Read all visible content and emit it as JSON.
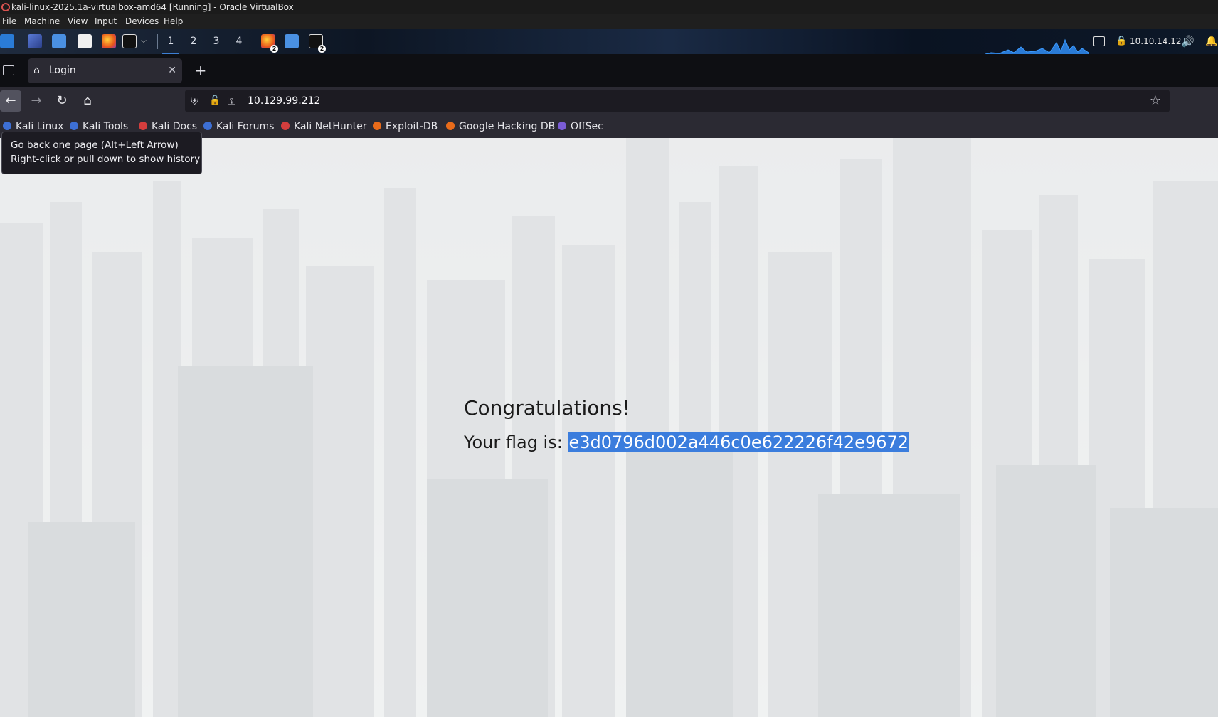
{
  "vbox": {
    "title": "kali-linux-2025.1a-virtualbox-amd64 [Running] - Oracle VirtualBox",
    "menu": [
      "File",
      "Machine",
      "View",
      "Input",
      "Devices",
      "Help"
    ]
  },
  "panel": {
    "workspaces": [
      "1",
      "2",
      "3",
      "4"
    ],
    "ip": "10.10.14.12",
    "badge_counts": [
      "2",
      "2"
    ]
  },
  "browser": {
    "tab_title": "Login",
    "new_tab": "+",
    "url": "10.129.99.212",
    "bookmarks": [
      {
        "label": "Kali Linux",
        "color": "#3d6fd4"
      },
      {
        "label": "Kali Tools",
        "color": "#3d6fd4"
      },
      {
        "label": "Kali Docs",
        "color": "#d43d3d"
      },
      {
        "label": "Kali Forums",
        "color": "#3d6fd4"
      },
      {
        "label": "Kali NetHunter",
        "color": "#d43d3d"
      },
      {
        "label": "Exploit-DB",
        "color": "#e86b1a"
      },
      {
        "label": "Google Hacking DB",
        "color": "#e86b1a"
      },
      {
        "label": "OffSec",
        "color": "#7a5cd6"
      }
    ],
    "tooltip": {
      "line1": "Go back one page (Alt+Left Arrow)",
      "line2": "Right-click or pull down to show history"
    }
  },
  "page": {
    "heading": "Congratulations!",
    "flag_prefix": "Your flag is: ",
    "flag": "e3d0796d002a446c0e622226f42e9672"
  },
  "colors": {
    "selection": "#3b7ddd",
    "browser_chrome": "#2b2a33"
  }
}
